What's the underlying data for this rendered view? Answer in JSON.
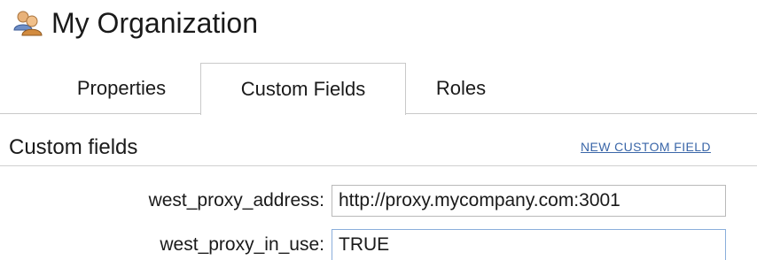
{
  "header": {
    "title": "My Organization",
    "icon": "organization-icon"
  },
  "tabs": [
    {
      "label": "Properties",
      "active": false
    },
    {
      "label": "Custom Fields",
      "active": true
    },
    {
      "label": "Roles",
      "active": false
    }
  ],
  "section": {
    "title": "Custom fields",
    "new_field_link": "NEW CUSTOM FIELD"
  },
  "fields": [
    {
      "label": "west_proxy_address:",
      "value": "http://proxy.mycompany.com:3001"
    },
    {
      "label": "west_proxy_in_use:",
      "value": "TRUE"
    }
  ],
  "colors": {
    "link": "#3a66a8",
    "border": "#c9c9c9",
    "focus_border": "#8aaedb"
  }
}
